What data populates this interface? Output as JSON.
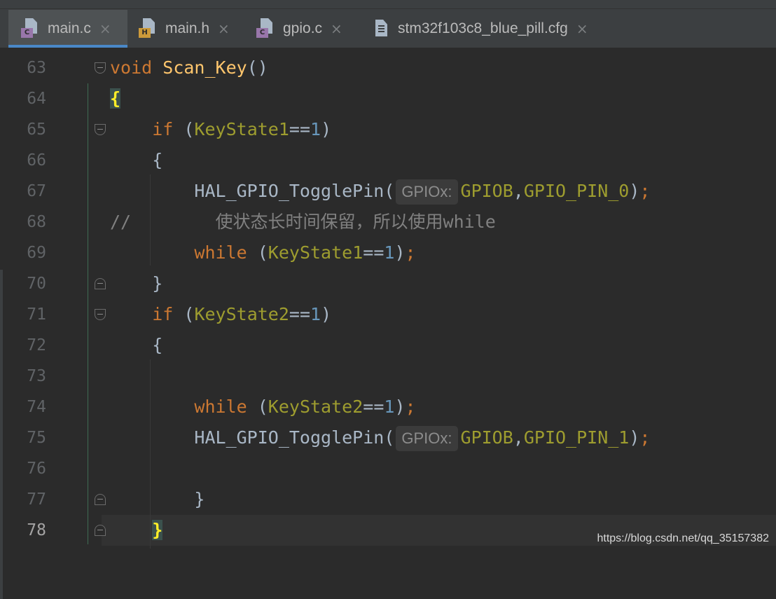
{
  "tabs": [
    {
      "label": "main.c",
      "badge": "C",
      "active": true,
      "kind": "c"
    },
    {
      "label": "main.h",
      "badge": "H",
      "active": false,
      "kind": "h"
    },
    {
      "label": "gpio.c",
      "badge": "C",
      "active": false,
      "kind": "c"
    },
    {
      "label": "stm32f103c8_blue_pill.cfg",
      "badge": "",
      "active": false,
      "kind": "doc"
    }
  ],
  "close_glyph": "×",
  "lines": [
    {
      "n": "63",
      "tokens": [
        [
          "kw",
          "void"
        ],
        [
          "",
          " "
        ],
        [
          "fn",
          "Scan_Key"
        ],
        [
          "",
          "()"
        ]
      ]
    },
    {
      "n": "64",
      "tokens": [
        [
          "brace-hl",
          "{"
        ]
      ]
    },
    {
      "n": "65",
      "tokens": [
        [
          "",
          "    "
        ],
        [
          "kw",
          "if"
        ],
        [
          "",
          " ("
        ],
        [
          "var",
          "KeyState1"
        ],
        [
          "",
          "=="
        ],
        [
          "num",
          "1"
        ],
        [
          "",
          ")"
        ]
      ]
    },
    {
      "n": "66",
      "tokens": [
        [
          "",
          "    {"
        ]
      ]
    },
    {
      "n": "67",
      "tokens": [
        [
          "",
          "        HAL_GPIO_TogglePin("
        ],
        [
          "hint",
          "GPIOx:"
        ],
        [
          "var",
          "GPIOB"
        ],
        [
          "",
          ","
        ],
        [
          "var",
          "GPIO_PIN_0"
        ],
        [
          "",
          ")"
        ],
        [
          "kw",
          ";"
        ]
      ]
    },
    {
      "n": "68",
      "tokens": [
        [
          "cmt",
          "//        使状态长时间保留，所以使用while"
        ]
      ]
    },
    {
      "n": "69",
      "tokens": [
        [
          "",
          "        "
        ],
        [
          "kw",
          "while"
        ],
        [
          "",
          " ("
        ],
        [
          "var",
          "KeyState1"
        ],
        [
          "",
          "=="
        ],
        [
          "num",
          "1"
        ],
        [
          "",
          ")"
        ],
        [
          "kw",
          ";"
        ]
      ]
    },
    {
      "n": "70",
      "tokens": [
        [
          "",
          "    }"
        ]
      ]
    },
    {
      "n": "71",
      "tokens": [
        [
          "",
          "    "
        ],
        [
          "kw",
          "if"
        ],
        [
          "",
          " ("
        ],
        [
          "var",
          "KeyState2"
        ],
        [
          "",
          "=="
        ],
        [
          "num",
          "1"
        ],
        [
          "",
          ")"
        ]
      ]
    },
    {
      "n": "72",
      "tokens": [
        [
          "",
          "    {"
        ]
      ]
    },
    {
      "n": "73",
      "tokens": []
    },
    {
      "n": "74",
      "tokens": [
        [
          "",
          "        "
        ],
        [
          "kw",
          "while"
        ],
        [
          "",
          " ("
        ],
        [
          "var",
          "KeyState2"
        ],
        [
          "",
          "=="
        ],
        [
          "num",
          "1"
        ],
        [
          "",
          ")"
        ],
        [
          "kw",
          ";"
        ]
      ]
    },
    {
      "n": "75",
      "tokens": [
        [
          "",
          "        HAL_GPIO_TogglePin("
        ],
        [
          "hint",
          "GPIOx:"
        ],
        [
          "var",
          "GPIOB"
        ],
        [
          "",
          ","
        ],
        [
          "var",
          "GPIO_PIN_1"
        ],
        [
          "",
          ")"
        ],
        [
          "kw",
          ";"
        ]
      ]
    },
    {
      "n": "76",
      "tokens": []
    },
    {
      "n": "77",
      "tokens": [
        [
          "",
          "        }"
        ]
      ]
    },
    {
      "n": "78",
      "tokens": [
        [
          "",
          "    "
        ],
        [
          "brace-hl",
          "}"
        ]
      ],
      "current": true
    }
  ],
  "watermark": "https://blog.csdn.net/qq_35157382"
}
